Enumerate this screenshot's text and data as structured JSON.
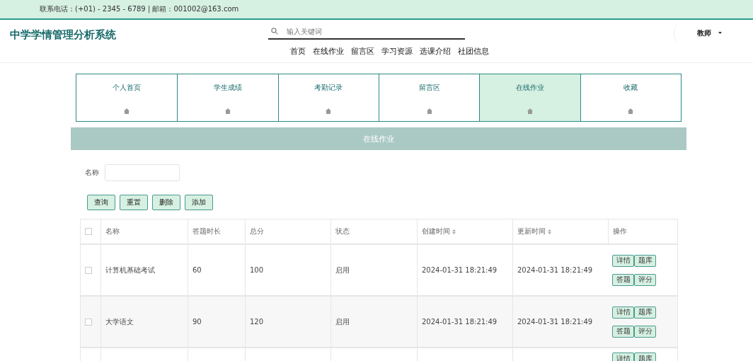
{
  "top_bar": {
    "contact": "联系电话：(+01) - 2345 - 6789 | 邮箱：001002@163.com"
  },
  "header": {
    "title": "中学学情管理分析系统",
    "search": {
      "placeholder": "输入关键词"
    },
    "user": {
      "name": "教师"
    },
    "nav": [
      {
        "label": "首页"
      },
      {
        "label": "在线作业"
      },
      {
        "label": "留言区"
      },
      {
        "label": "学习资源"
      },
      {
        "label": "选课介绍"
      },
      {
        "label": "社团信息"
      }
    ]
  },
  "menu_cards": [
    {
      "label": "个人首页",
      "selected": false
    },
    {
      "label": "学生成绩",
      "selected": false
    },
    {
      "label": "考勤记录",
      "selected": false
    },
    {
      "label": "留言区",
      "selected": false
    },
    {
      "label": "在线作业",
      "selected": true
    },
    {
      "label": "收藏",
      "selected": false
    }
  ],
  "banner": "在线作业",
  "filter": {
    "label": "名称"
  },
  "buttons": [
    "查询",
    "重置",
    "删除",
    "添加"
  ],
  "table": {
    "columns": [
      {
        "label": "名称",
        "sortable": false
      },
      {
        "label": "答题时长",
        "sortable": false
      },
      {
        "label": "总分",
        "sortable": false
      },
      {
        "label": "状态",
        "sortable": false
      },
      {
        "label": "创建时间",
        "sortable": true
      },
      {
        "label": "更新时间",
        "sortable": true
      },
      {
        "label": "操作",
        "sortable": false
      }
    ],
    "header_checked": false,
    "rows": [
      {
        "checked": false,
        "cells": [
          "计算机基础考试",
          "60",
          "100",
          "启用",
          "2024-01-31 18:21:49",
          "2024-01-31 18:21:49"
        ],
        "actions": [
          "详情",
          "题库",
          "答题",
          "评分"
        ]
      },
      {
        "checked": false,
        "cells": [
          "大学语文",
          "90",
          "120",
          "启用",
          "2024-01-31 18:21:49",
          "2024-01-31 18:21:49"
        ],
        "actions": [
          "详情",
          "题库",
          "答题",
          "评分"
        ]
      },
      {
        "actions": [
          "详情",
          "题库"
        ]
      }
    ]
  }
}
